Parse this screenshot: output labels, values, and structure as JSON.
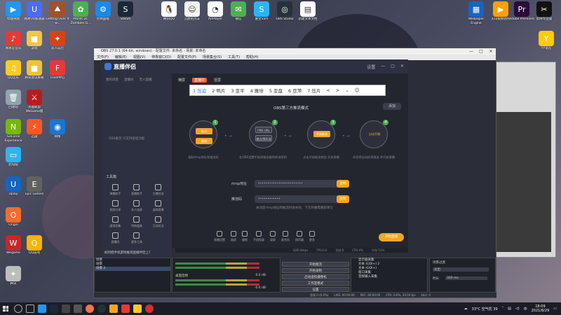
{
  "desktop": {
    "icons_left": [
      {
        "label": "哔哩视频",
        "color": "#2196f3",
        "glyph": "▶"
      },
      {
        "label": "网易UU加速器",
        "color": "#4a6cf7",
        "glyph": "U"
      },
      {
        "label": "Getting Over It w...",
        "color": "#a0522d",
        "glyph": "⛰"
      },
      {
        "label": "Plants vs. Zombies G...",
        "color": "#4caf50",
        "glyph": "✿"
      },
      {
        "label": "控制面板",
        "color": "#1e88e5",
        "glyph": "⚙"
      },
      {
        "label": "Steam",
        "color": "#1b2838",
        "glyph": "S"
      },
      {
        "label": "网易云音乐",
        "color": "#e53935",
        "glyph": "♪"
      },
      {
        "label": "游戏",
        "color": "#f5c542",
        "glyph": "■"
      },
      {
        "label": "双人成行",
        "color": "#d84315",
        "glyph": "✦"
      },
      {
        "label": "QQ音乐",
        "color": "#ffca28",
        "glyph": "♫"
      },
      {
        "label": "腾讯会议看看",
        "color": "#f0c040",
        "glyph": "■"
      },
      {
        "label": "Flash中心",
        "color": "#e53935",
        "glyph": "F"
      },
      {
        "label": "回收站",
        "color": "#90a4ae",
        "glyph": "🗑"
      },
      {
        "label": "英雄联盟WeGame版",
        "color": "#b71c1c",
        "glyph": "⚔"
      },
      {
        "label": "GeForce Experience",
        "color": "#76b900",
        "glyph": "N"
      },
      {
        "label": "迅雷",
        "color": "#ff5722",
        "glyph": "⚡"
      },
      {
        "label": "网络",
        "color": "#1976d2",
        "glyph": "◉"
      },
      {
        "label": "此电脑",
        "color": "#29b6f6",
        "glyph": "▭"
      },
      {
        "label": "Uplay",
        "color": "#1565c0",
        "glyph": "U"
      },
      {
        "label": "Epic Games",
        "color": "#616161",
        "glyph": "E"
      },
      {
        "label": "Origin",
        "color": "#f56c2d",
        "glyph": "O"
      },
      {
        "label": "Wegame",
        "color": "#c62828",
        "glyph": "W"
      },
      {
        "label": "QQ游戏",
        "color": "#ffb300",
        "glyph": "Q"
      },
      {
        "label": "腾讯",
        "color": "#bdbdbd",
        "glyph": "✦"
      },
      {
        "label": "穿越火线",
        "color": "#3e2723",
        "glyph": "✚"
      }
    ],
    "icons_top": [
      {
        "label": "腾讯QQ",
        "color": "#ffffff",
        "glyph": "🐧"
      },
      {
        "label": "沉默的羔羊",
        "color": "#f5f5f5",
        "glyph": "☺"
      },
      {
        "label": "AirPlayer",
        "color": "#ffffff",
        "glyph": "◔"
      },
      {
        "label": "微信",
        "color": "#4caf50",
        "glyph": "✉"
      },
      {
        "label": "重生Sam",
        "color": "#29b6f6",
        "glyph": "S"
      },
      {
        "label": "OBS Studio",
        "color": "#263238",
        "glyph": "◎"
      },
      {
        "label": "新建文本文档",
        "color": "#ffffff",
        "glyph": "▤"
      }
    ],
    "icons_right": [
      {
        "label": "Wallpaper Engine",
        "color": "#1565c0",
        "glyph": "▦"
      },
      {
        "label": "火山视频创作",
        "color": "#ffa000",
        "glyph": "▶"
      },
      {
        "label": "Adobe Premiere",
        "color": "#2a0a3a",
        "glyph": "Pr"
      },
      {
        "label": "剪映专业版",
        "color": "#111111",
        "glyph": "✂"
      },
      {
        "label": "YY语音",
        "color": "#ffcc00",
        "glyph": "Y"
      }
    ]
  },
  "obs": {
    "title": "OBS 27.0.1 (64-bit, windows) - 配置文件: 未命名 - 场景: 未命名",
    "menu": [
      "文件(F)",
      "编辑(E)",
      "视图(V)",
      "停靠窗口(D)",
      "配置文件(P)",
      "场景集合(S)",
      "工具(T)",
      "帮助(H)"
    ],
    "docks": {
      "scenes_title": "场景",
      "scenes": [
        "场景",
        "场景 2"
      ],
      "mixer_labels": [
        "桌面音频",
        "麦克风/Aux"
      ],
      "mixer_levels": [
        "0.0 dB",
        "-0.6 dB"
      ],
      "controls": [
        "开始推流",
        "开始录制",
        "启动虚拟摄像机",
        "工作室模式",
        "设置",
        "退出"
      ],
      "sources": [
        "显示器采集",
        "文本 (GDI+) 2",
        "文本 (GDI+)",
        "窗口采集",
        "音频输入采集"
      ],
      "transition_title": "场景过渡",
      "transition_type": "淡出",
      "transition_label": "时长",
      "transition_value": "300 ms"
    },
    "status": [
      "丢帧 0 (0.0%)",
      "LIVE: 00:00:00",
      "REC: 00:00:00",
      "CPU: 0.6%, 30.00 fps",
      "kb/s: 0"
    ]
  },
  "app": {
    "name": "直播伴侣",
    "header_right": [
      "设置",
      "—",
      "□",
      "✕"
    ],
    "left_tabs": [
      "我的场景",
      "直播间",
      "无人直播"
    ],
    "left_empty": "OBS推流 只支持基础功能",
    "tools_title": "工具箱",
    "tools": [
      "弹幕助手",
      "直播助手",
      "主播任务",
      "投屏分享",
      "多人连屏",
      "虚拟背景",
      "虚拟形象",
      "特效道具",
      "互动玩法",
      "直播间",
      "更多工具"
    ],
    "scene_tabs": [
      "横屏",
      "竖屏"
    ],
    "live_badge": "直播中",
    "mode_title": "OBS第三方推流模式",
    "add_button": "添加",
    "steps": [
      {
        "inner": "推流",
        "inner2": "",
        "caption": "复制rtmp地址和推流码"
      },
      {
        "inner": "FMS URL",
        "inner2": "输出/推码流",
        "caption": "在OBS设置中选择服务器和串流密钥"
      },
      {
        "inner": "开始推流",
        "inner2": "",
        "caption": "点击开始推流按钮 开启直播"
      },
      {
        "inner": "自动开播",
        "inner2": "",
        "caption": "伴侣将自动检测推流 并开启直播"
      }
    ],
    "rtmp_label": "rtmp地址",
    "rtmp_value": "••••••••••••••••••••••••",
    "key_label": "推流码",
    "key_value": "••••••••••••",
    "copy_label": "复制",
    "hint": "关闭后rtmp地址和推流码会失效，下次开播需重新填写",
    "bottom_tools": [
      "直播设置",
      "画质",
      "美颜",
      "手机投屏",
      "录屏",
      "麦克风",
      "扬声器",
      "更多"
    ],
    "go_live": "开始直播",
    "status_strip": [
      "码率:0kbps",
      "FPS:0.0",
      "丢帧:0",
      "CPU:4%",
      "内存:51%"
    ],
    "left_footer": "如何把手机游戏推到直播伴侣上?"
  },
  "ime": {
    "candidates": [
      "1 压迫",
      "2 鸭片",
      "3 亚平",
      "4 雅培",
      "5 亚盘",
      "6 亚萍",
      "7 压片"
    ],
    "nav": [
      "<",
      ">",
      "⌄",
      "☺"
    ]
  },
  "taskbar": {
    "weather": "33°C 空气优 39",
    "time": "18:09",
    "date": "2021/8/29"
  }
}
